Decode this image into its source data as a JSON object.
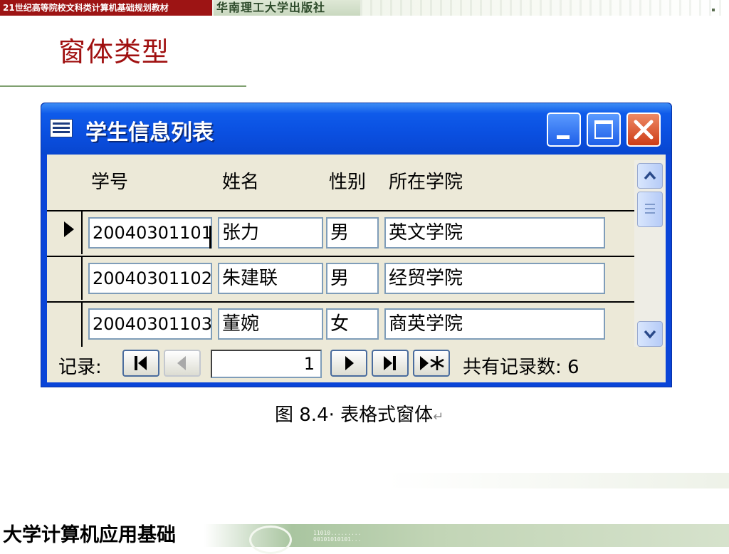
{
  "banner": {
    "series": "21世纪高等院校文科类计算机基础规划教材",
    "publisher": "华南理工大学出版社"
  },
  "page": {
    "title": "窗体类型"
  },
  "window": {
    "title": "学生信息列表",
    "icon": "form-icon",
    "controls": [
      "minimize-icon",
      "maximize-icon",
      "close-icon"
    ]
  },
  "table": {
    "headers": [
      "学号",
      "姓名",
      "性别",
      "所在学院"
    ],
    "rows": [
      [
        "20040301101",
        "张力",
        "男",
        "英文学院"
      ],
      [
        "20040301102",
        "朱建联",
        "男",
        "经贸学院"
      ],
      [
        "20040301103",
        "董婉",
        "女",
        "商英学院"
      ]
    ]
  },
  "navigation": {
    "label": "记录:",
    "current": "1",
    "count_label": "共有记录数: 6",
    "buttons": [
      "first-record-icon",
      "prev-record-icon",
      "next-record-icon",
      "last-record-icon",
      "new-record-icon"
    ]
  },
  "caption": {
    "text": "图 8.4· 表格式窗体",
    "mark": "↵"
  },
  "footer": {
    "title": "大学计算机应用基础",
    "digits_1": "11010.........",
    "digits_2": "00101010101..."
  },
  "colors": {
    "title_red": "#a01010",
    "xp_blue": "#0a45d8",
    "form_bg": "#ece9d8",
    "banner_red": "#9d1414"
  }
}
